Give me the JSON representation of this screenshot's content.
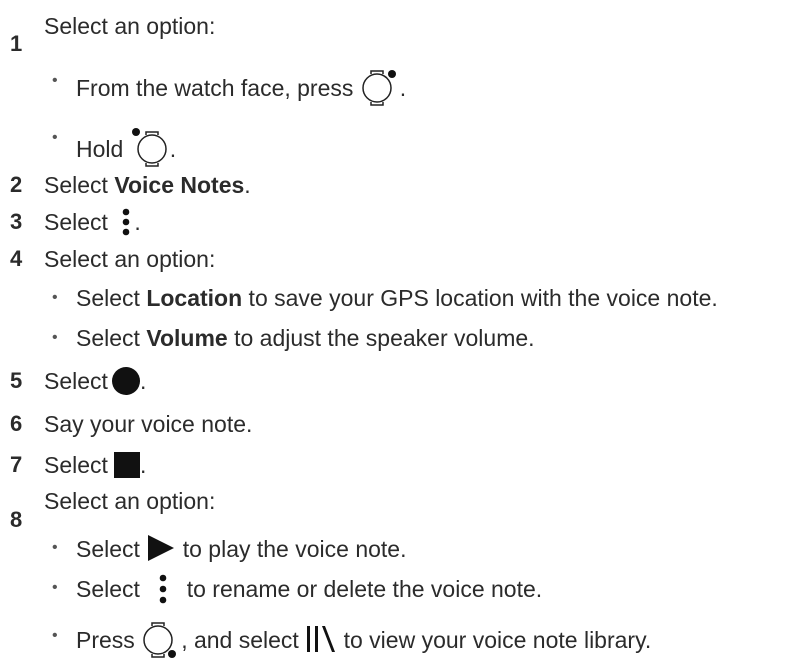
{
  "steps": [
    {
      "number": "1",
      "intro": "Select an option:",
      "bullets": [
        {
          "before": "From the watch face, press",
          "after": "."
        },
        {
          "before": "Hold",
          "after": "."
        }
      ]
    },
    {
      "number": "2",
      "prefix": "Select ",
      "bold": "Voice Notes",
      "suffix": "."
    },
    {
      "number": "3",
      "prefix": "Select",
      "suffix": "."
    },
    {
      "number": "4",
      "intro": "Select an option:",
      "bullets": [
        {
          "prefix": "Select ",
          "bold": "Location",
          "suffix": " to save your GPS location with the voice note."
        },
        {
          "prefix": "Select ",
          "bold": "Volume",
          "suffix": " to adjust the speaker volume."
        }
      ]
    },
    {
      "number": "5",
      "prefix": "Select",
      "suffix": "."
    },
    {
      "number": "6",
      "text": "Say your voice note."
    },
    {
      "number": "7",
      "prefix": "Select",
      "suffix": "."
    },
    {
      "number": "8",
      "intro": "Select an option:",
      "bullets": [
        {
          "before": "Select",
          "after": "to play the voice note."
        },
        {
          "before": "Select",
          "after": "to rename or delete the voice note."
        },
        {
          "before": "Press",
          "middle": ", and select",
          "after": "to view your voice note library."
        }
      ]
    }
  ],
  "icons": {
    "watch_button_top_right": "watch-button-top-right-icon",
    "watch_button_top_left": "watch-button-top-left-icon",
    "watch_button_bottom_right": "watch-button-bottom-right-icon",
    "menu": "vertical-dots-menu-icon",
    "record": "record-circle-icon",
    "stop": "stop-square-icon",
    "play": "play-triangle-icon",
    "library": "library-icon"
  }
}
